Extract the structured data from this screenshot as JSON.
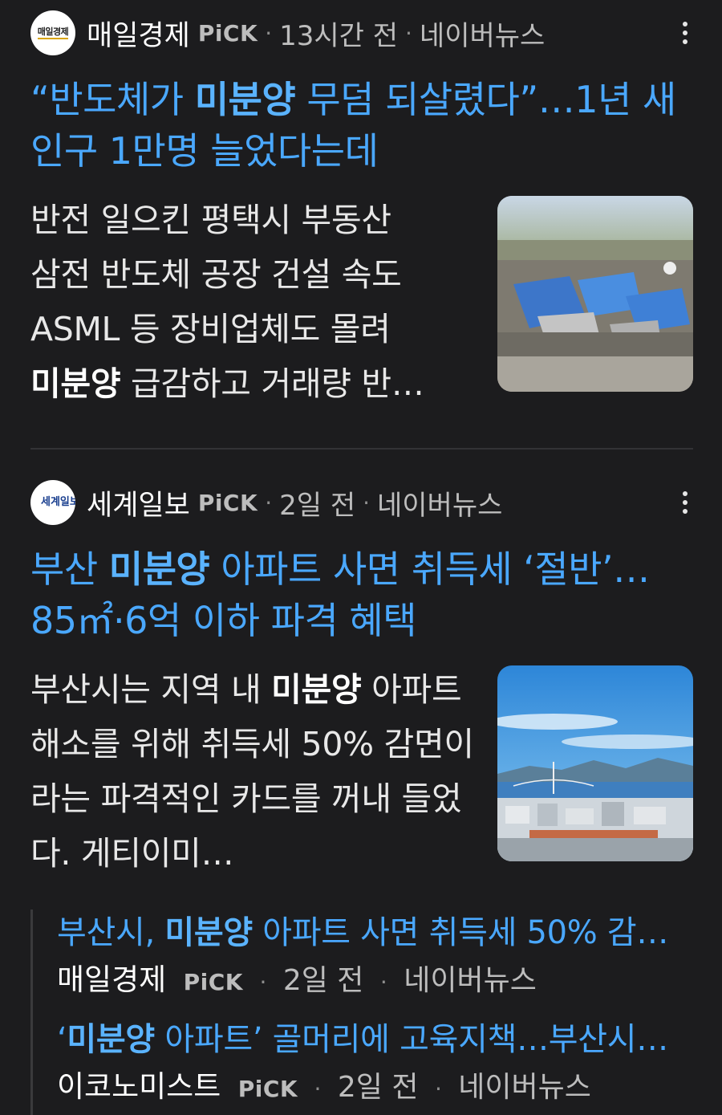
{
  "articles": [
    {
      "press": "매일경제",
      "logo_text": "매일경제",
      "pick": "PiCK",
      "time": "13시간 전",
      "platform": "네이버뉴스",
      "headline_pre": "“반도체가 ",
      "headline_bold": "미분양",
      "headline_post": " 무덤 되살렸다”…1년 새 인구 1만명 늘었다는데",
      "summary_lines": [
        "반전 일으킨 평택시 부동산",
        "삼전 반도체 공장 건설 속도",
        "ASML 등 장비업체도 몰려"
      ],
      "summary_last_bold": "미분양",
      "summary_last_rest": " 급감하고 거래량 반…",
      "thumb_icon": "factory-aerial-photo"
    },
    {
      "press": "세계일보",
      "logo_text": "세계일보",
      "pick": "PiCK",
      "time": "2일 전",
      "platform": "네이버뉴스",
      "headline_pre": "부산 ",
      "headline_bold": "미분양",
      "headline_post": " 아파트 사면 취득세 ‘절반’… 85㎡·6억 이하 파격 혜택",
      "summary_pre": "부산시는 지역 내 ",
      "summary_bold": "미분양",
      "summary_post": " 아파트 해소를 위해 취득세 50% 감면이라는 파격적인 카드를 꺼내 들었다. 게티이미…",
      "thumb_icon": "busan-city-photo"
    }
  ],
  "related": [
    {
      "title_pre": "부산시, ",
      "title_bold": "미분양",
      "title_post": " 아파트 사면 취득세 50% 감…",
      "press": "매일경제",
      "pick": "PiCK",
      "time": "2일 전",
      "platform": "네이버뉴스"
    },
    {
      "title_pre": "‘",
      "title_bold": "미분양",
      "title_post": " 아파트’ 골머리에 고육지책…부산시…",
      "press": "이코노미스트",
      "pick": "PiCK",
      "time": "2일 전",
      "platform": "네이버뉴스"
    }
  ],
  "dot_separator": "·",
  "colors": {
    "background": "#1c1c1e",
    "link": "#4aa8ff",
    "text": "#e8e8e8",
    "meta": "#bdbdbd"
  }
}
